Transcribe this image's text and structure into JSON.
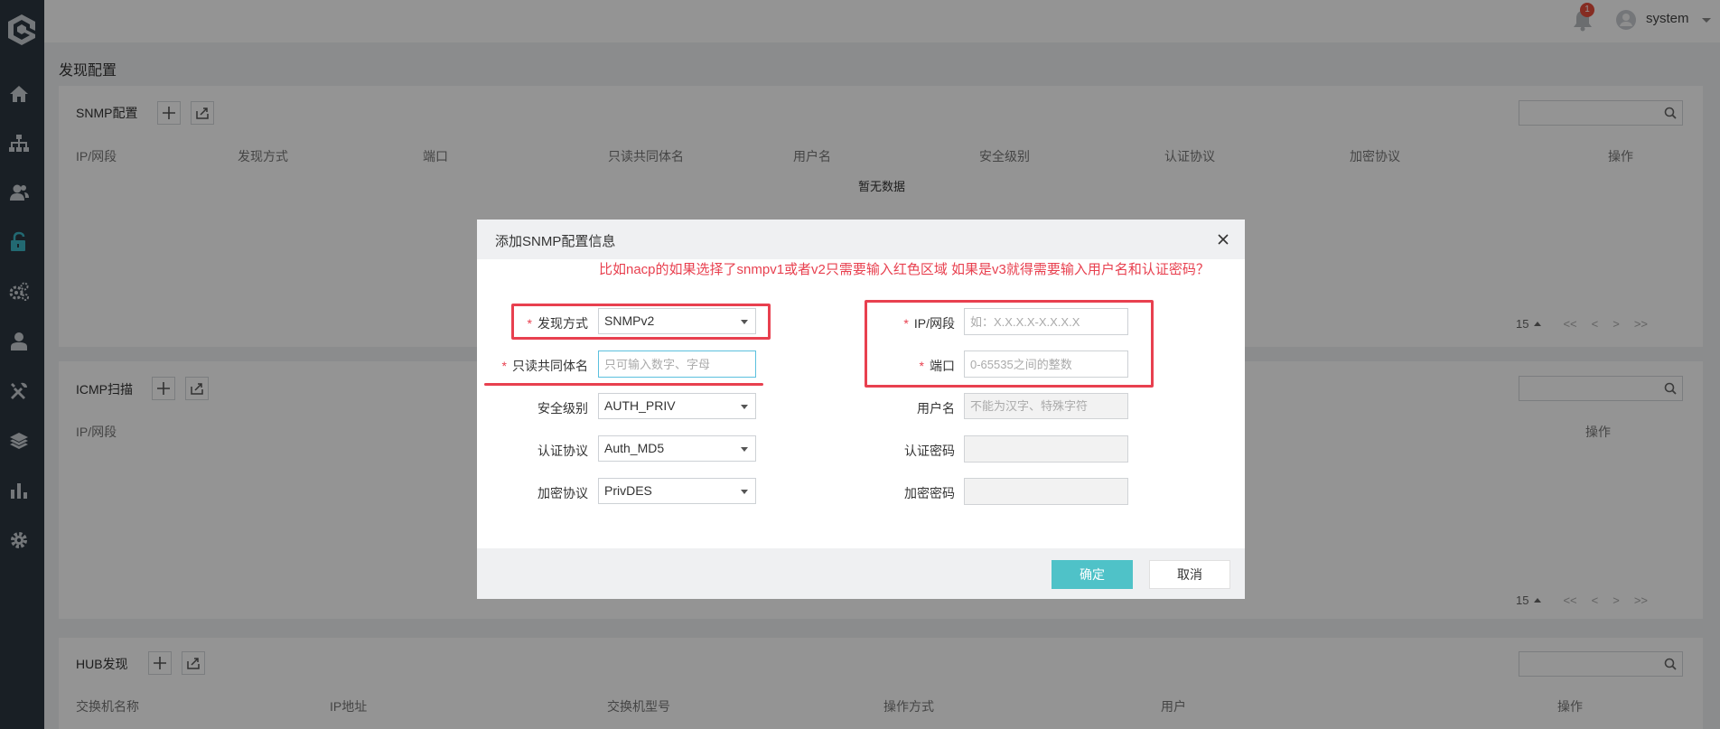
{
  "header": {
    "notification_count": "1",
    "username": "system"
  },
  "page": {
    "title": "发现配置"
  },
  "snmp_card": {
    "title": "SNMP配置",
    "columns": [
      "IP/网段",
      "发现方式",
      "端口",
      "只读共同体名",
      "用户名",
      "安全级别",
      "认证协议",
      "加密协议",
      "操作"
    ],
    "empty_text": "暂无数据",
    "page_size": "15",
    "pager": [
      "<<",
      "<",
      ">",
      ">>"
    ]
  },
  "icmp_card": {
    "title": "ICMP扫描",
    "columns": [
      "IP/网段",
      "操作"
    ],
    "page_size": "15",
    "pager": [
      "<<",
      "<",
      ">",
      ">>"
    ]
  },
  "hub_card": {
    "title": "HUB发现",
    "columns": [
      "交换机名称",
      "IP地址",
      "交换机型号",
      "操作方式",
      "用户",
      "操作"
    ]
  },
  "modal": {
    "title": "添加SNMP配置信息",
    "note": "比如nacp的如果选择了snmpv1或者v2只需要输入红色区域 如果是v3就得需要输入用户名和认证密码？",
    "required_mark": "*",
    "fields": {
      "discovery_method": {
        "label": "发现方式",
        "value": "SNMPv2"
      },
      "community": {
        "label": "只读共同体名",
        "placeholder": "只可输入数字、字母"
      },
      "security_level": {
        "label": "安全级别",
        "value": "AUTH_PRIV"
      },
      "auth_protocol": {
        "label": "认证协议",
        "value": "Auth_MD5"
      },
      "encrypt_protocol": {
        "label": "加密协议",
        "value": "PrivDES"
      },
      "ip_range": {
        "label": "IP/网段",
        "placeholder": "如：X.X.X.X-X.X.X.X"
      },
      "port": {
        "label": "端口",
        "placeholder": "0-65535之间的整数"
      },
      "username": {
        "label": "用户名",
        "placeholder": "不能为汉字、特殊字符"
      },
      "auth_password": {
        "label": "认证密码"
      },
      "encrypt_password": {
        "label": "加密密码"
      }
    },
    "ok_label": "确定",
    "cancel_label": "取消"
  },
  "colors": {
    "sidebar": "#2b3640",
    "accent": "#4fc2c8",
    "annotation_red": "#e8404f",
    "badge_red": "#e74c3c"
  },
  "sidebar_icons": [
    "logo-icon",
    "home-icon",
    "topology-icon",
    "users-icon",
    "unlock-icon",
    "gears-icon",
    "user-icon",
    "tools-icon",
    "layers-icon",
    "bar-chart-icon",
    "settings-icon"
  ]
}
